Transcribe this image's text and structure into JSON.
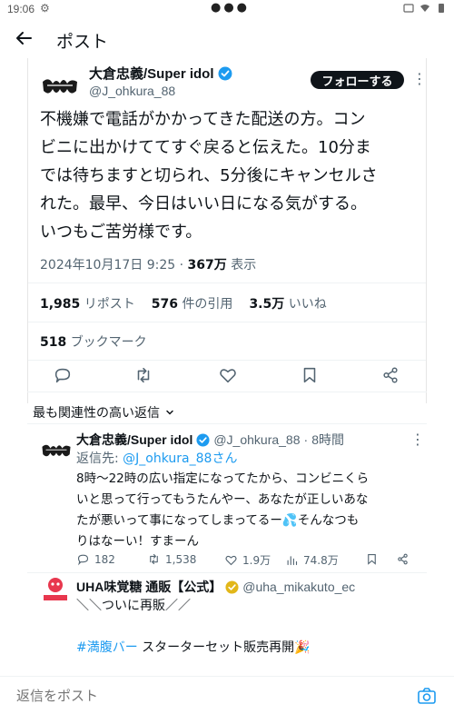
{
  "status_bar": {
    "time": "19:06"
  },
  "header": {
    "title": "ポスト"
  },
  "tweet": {
    "author_name": "大倉忠義/Super idol",
    "handle": "@J_ohkura_88",
    "follow_label": "フォローする",
    "text_lines": [
      "不機嫌で電話がかかってきた配送の方。コン",
      "ビニに出かけててすぐ戻ると伝えた。10分ま",
      "では待ちますと切られ、5分後にキャンセルさ",
      "れた。最早、今日はいい日になる気がする。",
      "いつもご苦労様です。"
    ],
    "datetime": "2024年10月17日 9:25",
    "views": "367万",
    "views_label": "表示",
    "reposts": "1,985",
    "reposts_label": "リポスト",
    "quotes": "576",
    "quotes_label": "件の引用",
    "likes": "3.5万",
    "likes_label": "いいね",
    "bookmarks": "518",
    "bookmarks_label": "ブックマーク"
  },
  "replies_sort": {
    "label": "最も関連性の高い返信"
  },
  "reply1": {
    "author_name": "大倉忠義/Super idol",
    "handle": "@J_ohkura_88",
    "time": "8時間",
    "reply_to_label": "返信先:",
    "reply_to_handle": "@J_ohkura_88さん",
    "text_lines": [
      "8時〜22時の広い指定になってたから、コンビニくら",
      "いと思って行ってもうたんやー、あなたが正しいあな",
      "たが悪いって事になってしまってるー💦そんなつも",
      "りはなーい！すまーん"
    ],
    "replies": "182",
    "reposts": "1,538",
    "likes": "1.9万",
    "views": "74.8万"
  },
  "reply2": {
    "author_name": "UHA味覚糖 通販【公式】",
    "handle": "@uha_mikakuto_ec",
    "line1": "＼＼ついに再販／／",
    "hashtag": "#満腹バー",
    "line2_rest": " スターターセット販売再開🎉",
    "avatar_text": "UHA味覚糖"
  },
  "bottom": {
    "placeholder": "返信をポスト"
  },
  "colors": {
    "accent": "#1d9bf0",
    "verified": "#1d9bf0",
    "gold_badge": "#e2b719",
    "follow_bg": "#0f1419"
  }
}
